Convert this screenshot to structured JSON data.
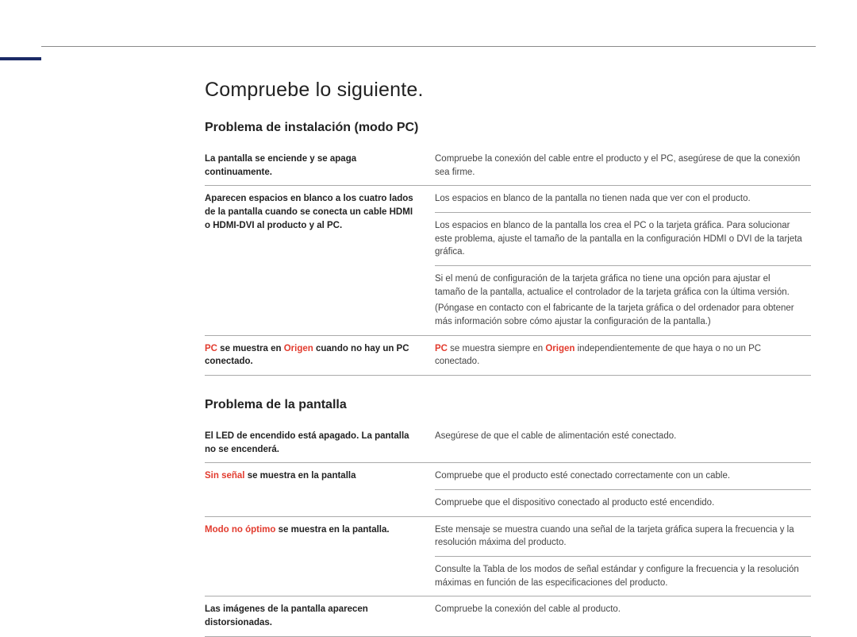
{
  "title": "Compruebe lo siguiente.",
  "section1": {
    "heading": "Problema de instalación (modo PC)",
    "r1_left": "La pantalla se enciende y se apaga continuamente.",
    "r1_right": "Compruebe la conexión del cable entre el producto y el PC, asegúrese de que la conexión sea firme.",
    "r2_left": "Aparecen espacios en blanco a los cuatro lados de la pantalla cuando se conecta un cable HDMI o HDMI-DVI al producto y al PC.",
    "r2_right_a": "Los espacios en blanco de la pantalla no tienen nada que ver con el producto.",
    "r2_right_b": "Los espacios en blanco de la pantalla los crea el PC o la tarjeta gráfica. Para solucionar este problema, ajuste el tamaño de la pantalla en la configuración HDMI o DVI de la tarjeta gráfica.",
    "r2_right_c": "Si el menú de configuración de la tarjeta gráfica no tiene una opción para ajustar el tamaño de la pantalla, actualice el controlador de la tarjeta gráfica con la última versión.",
    "r2_right_d": "(Póngase en contacto con el fabricante de la tarjeta gráfica o del ordenador para obtener más información sobre cómo ajustar la configuración de la pantalla.)",
    "r3_left_a": "PC",
    "r3_left_b": " se muestra en ",
    "r3_left_c": "Origen",
    "r3_left_d": " cuando no hay un PC conectado.",
    "r3_right_a": "PC",
    "r3_right_b": " se muestra siempre en ",
    "r3_right_c": "Origen",
    "r3_right_d": " independientemente de que haya o no un PC conectado."
  },
  "section2": {
    "heading": "Problema de la pantalla",
    "r1_left": "El LED de encendido está apagado. La pantalla no se encenderá.",
    "r1_right": "Asegúrese de que el cable de alimentación esté conectado.",
    "r2_left_a": "Sin señal",
    "r2_left_b": " se muestra en la pantalla",
    "r2_right_a": "Compruebe que el producto esté conectado correctamente con un cable.",
    "r2_right_b": "Compruebe que el dispositivo conectado al producto esté encendido.",
    "r3_left_a": "Modo no óptimo",
    "r3_left_b": " se muestra en la pantalla.",
    "r3_right_a": "Este mensaje se muestra cuando una señal de la tarjeta gráfica supera la frecuencia y la resolución máxima del producto.",
    "r3_right_b": "Consulte la Tabla de los modos de señal estándar y configure la frecuencia y la resolución máximas en función de las especificaciones del producto.",
    "r4_left": "Las imágenes de la pantalla aparecen distorsionadas.",
    "r4_right": "Compruebe la conexión del cable al producto."
  }
}
